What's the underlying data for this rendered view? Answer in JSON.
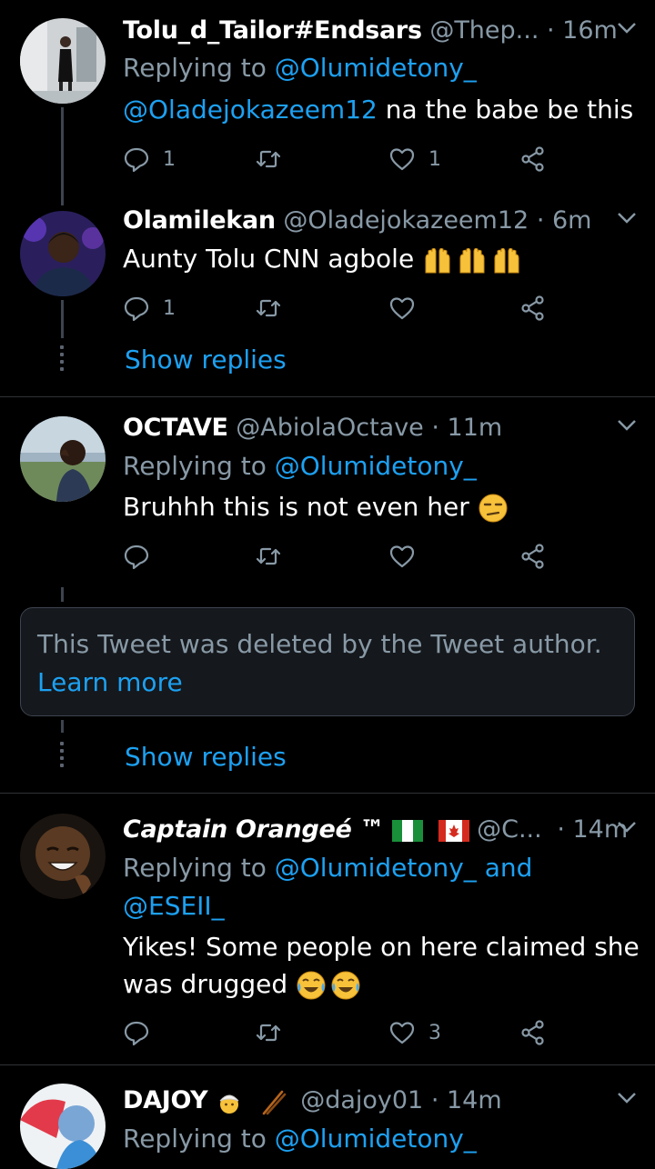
{
  "tweets": [
    {
      "name": "Tolu_d_Tailor#Endsars",
      "handle": "@Thep...",
      "time": "· 16m",
      "replying_prefix": "Replying to",
      "replying_to": "@Olumidetony_",
      "text_mention": "@Oladejokazeem12",
      "text": " na the babe be this",
      "reply_count": "1",
      "retweet_count": "",
      "like_count": "1"
    },
    {
      "name": "Olamilekan",
      "handle": "@Oladejokazeem12",
      "time": "· 6m",
      "text": "Aunty Tolu CNN agbole",
      "reply_count": "1",
      "retweet_count": "",
      "like_count": "",
      "show_replies": "Show replies"
    },
    {
      "name": "OCTAVE",
      "handle": "@AbiolaOctave",
      "time": "· 11m",
      "replying_prefix": "Replying to",
      "replying_to": "@Olumidetony_",
      "text": "Bruhhh this is not even her",
      "reply_count": "",
      "retweet_count": "",
      "like_count": ""
    },
    {
      "name": "Captain Orangeé ™",
      "handle": "@C...",
      "time": "· 14m",
      "replying_prefix": "Replying to",
      "replying_to": "@Olumidetony_ and",
      "replying_to_2": "@ESEII_",
      "text_line1": "Yikes! Some people on here claimed she",
      "text_line2": "was drugged",
      "reply_count": "",
      "retweet_count": "",
      "like_count": "3"
    },
    {
      "name": "DAJOY",
      "handle": "@dajoy01",
      "time": "· 14m",
      "replying_prefix": "Replying to",
      "replying_to": "@Olumidetony_"
    }
  ],
  "deleted": {
    "text": "This Tweet was deleted by the Tweet author.",
    "learn_more": "Learn more",
    "show_replies": "Show replies"
  },
  "colors": {
    "background": "#000000",
    "text": "#ffffff",
    "muted": "#8899a6",
    "link": "#1da1f2",
    "divider": "#2f3336"
  },
  "icons": [
    "reply-icon",
    "retweet-icon",
    "like-icon",
    "share-icon",
    "chevron-down-icon"
  ]
}
